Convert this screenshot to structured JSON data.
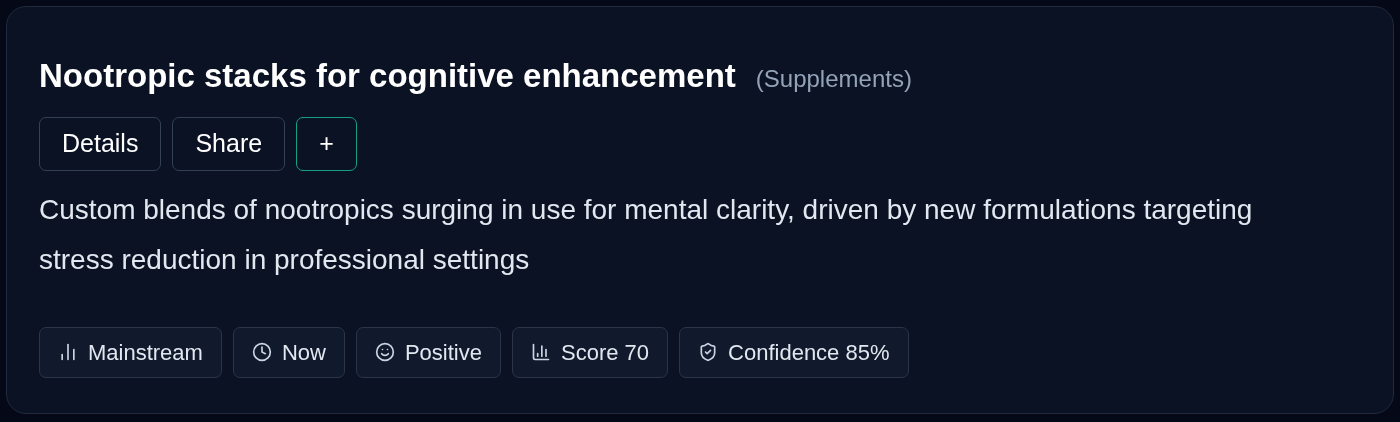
{
  "card": {
    "title": "Nootropic stacks for cognitive enhancement",
    "category": "(Supplements)",
    "actions": [
      {
        "label": "Details",
        "kind": "plain"
      },
      {
        "label": "Share",
        "kind": "plain"
      },
      {
        "label": "+",
        "kind": "accent"
      }
    ],
    "description": "Custom blends of nootropics surging in use for mental clarity, driven by new formulations targeting stress reduction in professional settings",
    "badges": [
      {
        "kind": "stage",
        "label": "Mainstream"
      },
      {
        "kind": "time",
        "label": "Now"
      },
      {
        "kind": "sentiment",
        "label": "Positive"
      },
      {
        "kind": "score",
        "label": "Score 70"
      },
      {
        "kind": "confidence",
        "label": "Confidence 85%"
      }
    ]
  }
}
